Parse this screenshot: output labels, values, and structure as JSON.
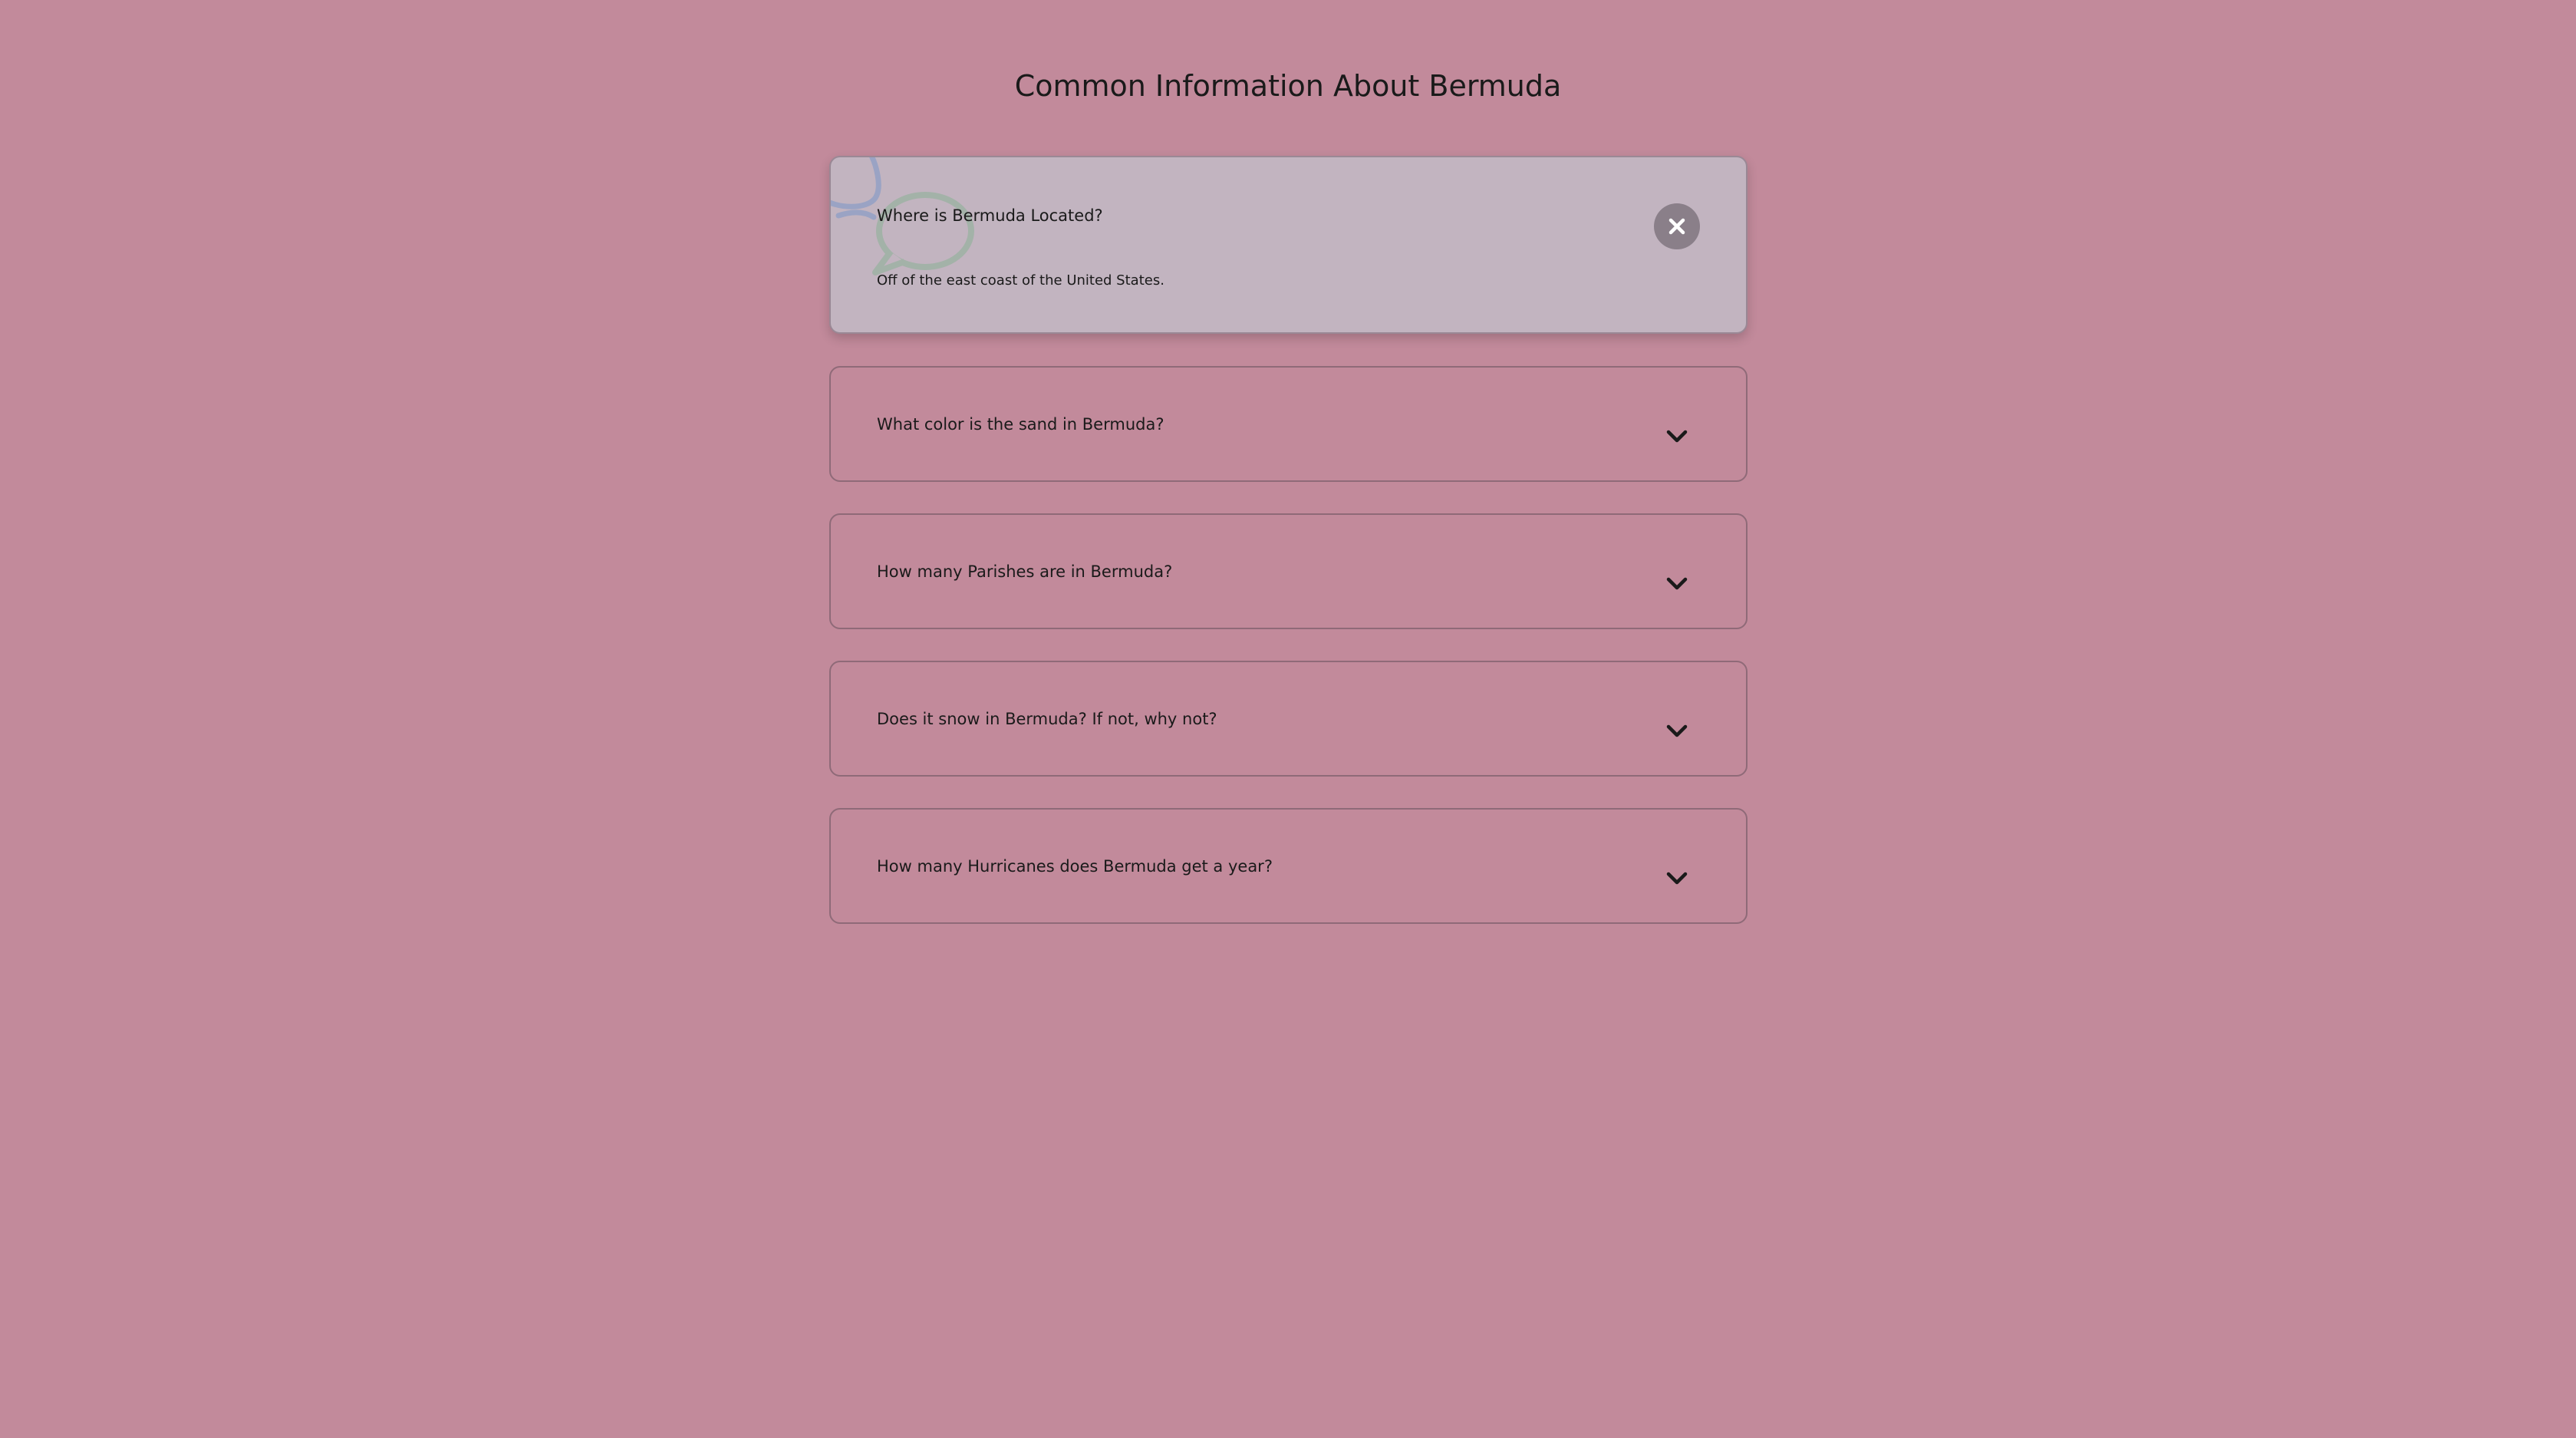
{
  "page": {
    "title": "Common Information About Bermuda"
  },
  "colors": {
    "background": "#c28a9b",
    "active_card": "#c2b4c0",
    "card_border": "#8f6a78",
    "close_button": "#8a7f89"
  },
  "faq": {
    "items": [
      {
        "question": "Where is Bermuda Located?",
        "answer": "Off of the east coast of the United States.",
        "expanded": true,
        "toggle_icon": "close-icon"
      },
      {
        "question": "What color is the sand in Bermuda?",
        "expanded": false,
        "toggle_icon": "chevron-down-icon"
      },
      {
        "question": "How many Parishes are in Bermuda?",
        "expanded": false,
        "toggle_icon": "chevron-down-icon"
      },
      {
        "question": "Does it snow in Bermuda? If not, why not?",
        "expanded": false,
        "toggle_icon": "chevron-down-icon"
      },
      {
        "question": "How many Hurricanes does Bermuda get a year?",
        "expanded": false,
        "toggle_icon": "chevron-down-icon"
      }
    ]
  }
}
